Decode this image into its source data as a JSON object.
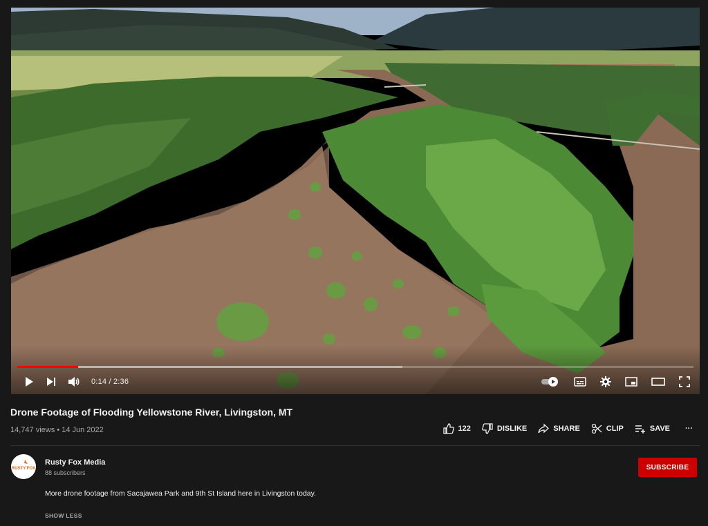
{
  "player": {
    "time_display": "0:14 / 2:36",
    "progress_fraction": 0.09,
    "buffered_fraction": 0.57,
    "accent_color": "#ff0000",
    "controls_left": [
      "play-icon",
      "next-icon",
      "volume-icon"
    ],
    "controls_right": [
      "autoplay-toggle",
      "subtitles-icon",
      "settings-gear-icon",
      "miniplayer-icon",
      "theater-mode-icon",
      "fullscreen-icon"
    ]
  },
  "video": {
    "title": "Drone Footage of Flooding Yellowstone River, Livingston, MT",
    "views": "14,747 views",
    "separator": "•",
    "date": "14 Jun 2022"
  },
  "actions": {
    "like_count": "122",
    "dislike_label": "DISLIKE",
    "share_label": "SHARE",
    "clip_label": "CLIP",
    "save_label": "SAVE",
    "more_label": "···"
  },
  "channel": {
    "name": "Rusty Fox Media",
    "subscribers": "88 subscribers",
    "subscribe_label": "SUBSCRIBE",
    "subscribe_color": "#cc0000",
    "avatar_text": "RUSTY FOX"
  },
  "description": {
    "text": "More drone footage from Sacajawea Park and 9th St Island here in Livingston today.",
    "toggle_label": "SHOW LESS"
  }
}
